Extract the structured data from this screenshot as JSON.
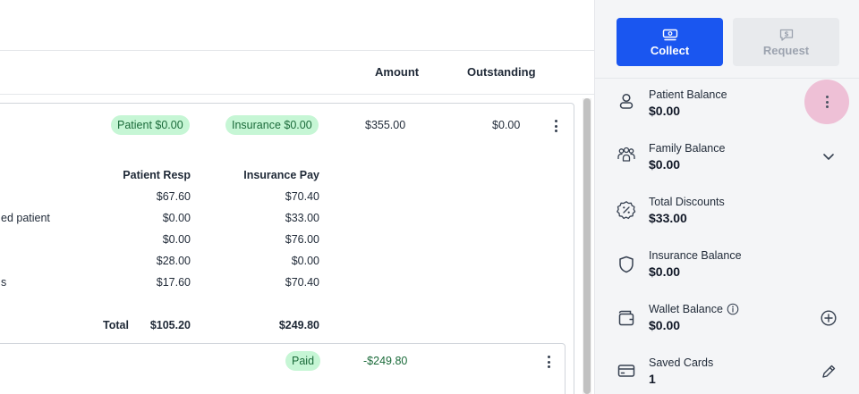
{
  "columns": {
    "amount": "Amount",
    "outstanding": "Outstanding"
  },
  "claim": {
    "patient_pill": "Patient $0.00",
    "insurance_pill": "Insurance $0.00",
    "amount": "$355.00",
    "outstanding": "$0.00",
    "breakdown_headers": {
      "patient_resp": "Patient Resp",
      "insurance_pay": "Insurance Pay"
    },
    "rows": [
      {
        "label": "",
        "patient": "$67.60",
        "insurance": "$70.40"
      },
      {
        "label": "ed patient",
        "patient": "$0.00",
        "insurance": "$33.00"
      },
      {
        "label": "",
        "patient": "$0.00",
        "insurance": "$76.00"
      },
      {
        "label": "",
        "patient": "$28.00",
        "insurance": "$0.00"
      },
      {
        "label": "s",
        "patient": "$17.60",
        "insurance": "$70.40"
      }
    ],
    "total_label": "Total",
    "total_patient": "$105.20",
    "total_insurance": "$249.80"
  },
  "payment": {
    "status": "Paid",
    "amount": "-$249.80"
  },
  "actions": {
    "collect": "Collect",
    "request": "Request"
  },
  "balances": [
    {
      "label": "Patient Balance",
      "value": "$0.00",
      "icon": "person-icon",
      "action": "more-menu"
    },
    {
      "label": "Family Balance",
      "value": "$0.00",
      "icon": "family-icon",
      "action": "chevron-down"
    },
    {
      "label": "Total Discounts",
      "value": "$33.00",
      "icon": "discount-icon",
      "action": ""
    },
    {
      "label": "Insurance Balance",
      "value": "$0.00",
      "icon": "shield-icon",
      "action": ""
    },
    {
      "label": "Wallet Balance",
      "value": "$0.00",
      "icon": "wallet-icon",
      "action": "add"
    },
    {
      "label": "Saved Cards",
      "value": "1",
      "icon": "card-icon",
      "action": "edit"
    }
  ],
  "colors": {
    "accent": "#1a56f0",
    "pill_bg": "#c6f6d5",
    "pill_text": "#1b6b3a",
    "paid_amount": "#1b6b3a",
    "menu_highlight": "#eec0d6"
  }
}
